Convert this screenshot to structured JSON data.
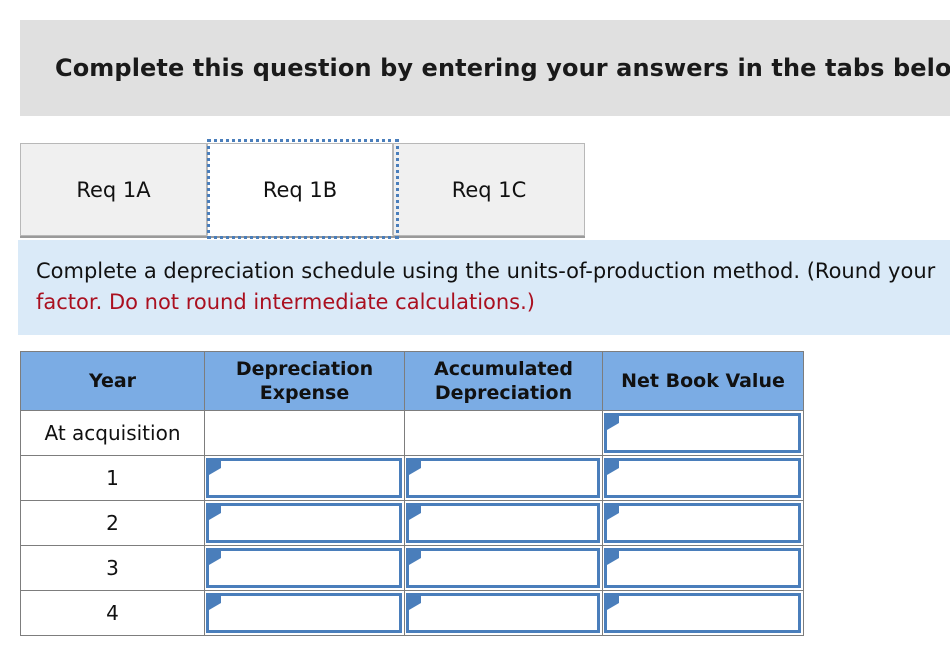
{
  "banner": {
    "title": "Complete this question by entering your answers in the tabs below."
  },
  "tabs": {
    "items": [
      {
        "label": "Req 1A",
        "active": false
      },
      {
        "label": "Req 1B",
        "active": true
      },
      {
        "label": "Req 1C",
        "active": false
      }
    ],
    "active_index": 1
  },
  "instructions": {
    "line1": "Complete a depreciation schedule using the units-of-production method. (Round your",
    "line2": "factor. Do not round intermediate calculations.)",
    "line1_color": "#111111",
    "line2_color": "#aa1020"
  },
  "table": {
    "headers": [
      "Year",
      "Depreciation Expense",
      "Accumulated Depreciation",
      "Net Book Value"
    ],
    "header_background": "#7bace4",
    "input_border_color": "#4a7ebb",
    "rows": [
      {
        "year": "At acquisition",
        "depreciation_expense": "",
        "accumulated_depreciation": "",
        "net_book_value": "",
        "cells_editable": [
          false,
          false,
          true
        ]
      },
      {
        "year": "1",
        "depreciation_expense": "",
        "accumulated_depreciation": "",
        "net_book_value": "",
        "cells_editable": [
          true,
          true,
          true
        ]
      },
      {
        "year": "2",
        "depreciation_expense": "",
        "accumulated_depreciation": "",
        "net_book_value": "",
        "cells_editable": [
          true,
          true,
          true
        ]
      },
      {
        "year": "3",
        "depreciation_expense": "",
        "accumulated_depreciation": "",
        "net_book_value": "",
        "cells_editable": [
          true,
          true,
          true
        ]
      },
      {
        "year": "4",
        "depreciation_expense": "",
        "accumulated_depreciation": "",
        "net_book_value": "",
        "cells_editable": [
          true,
          true,
          true
        ]
      }
    ]
  }
}
